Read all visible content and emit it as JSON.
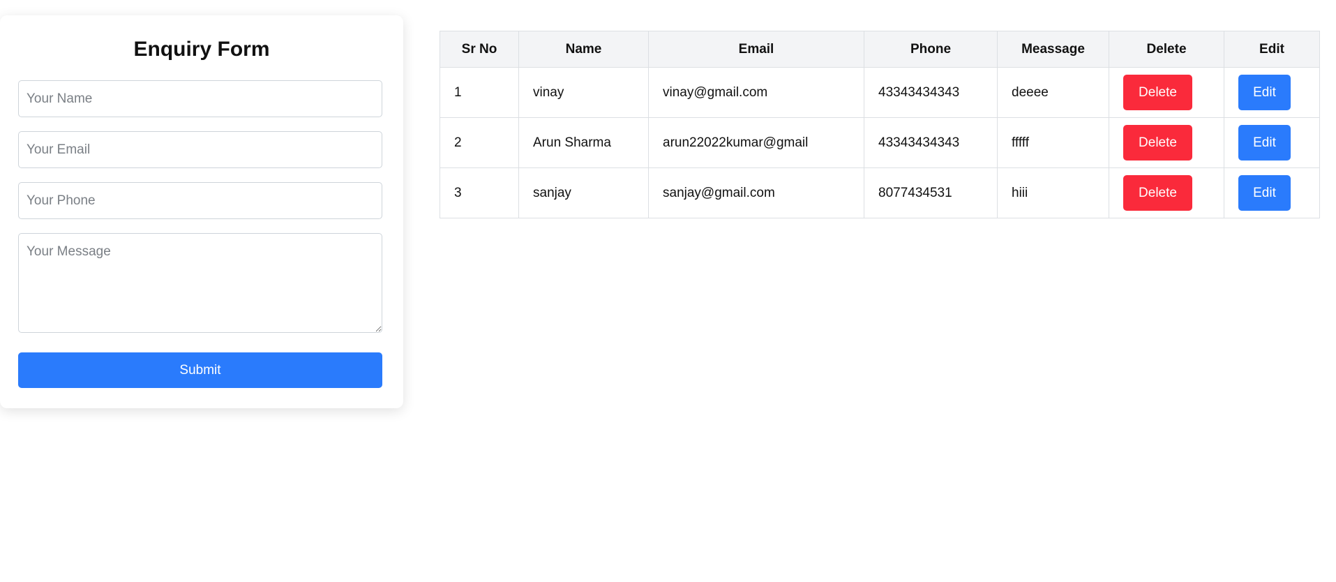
{
  "form": {
    "title": "Enquiry Form",
    "name_placeholder": "Your Name",
    "email_placeholder": "Your Email",
    "phone_placeholder": "Your Phone",
    "message_placeholder": "Your Message",
    "submit_label": "Submit"
  },
  "table": {
    "headers": [
      "Sr No",
      "Name",
      "Email",
      "Phone",
      "Meassage",
      "Delete",
      "Edit"
    ],
    "rows": [
      {
        "sr": "1",
        "name": "vinay",
        "email": "vinay@gmail.com",
        "phone": "43343434343",
        "message": "deeee",
        "delete_label": "Delete",
        "edit_label": "Edit"
      },
      {
        "sr": "2",
        "name": "Arun Sharma",
        "email": "arun22022kumar@gmail",
        "phone": "43343434343",
        "message": "fffff",
        "delete_label": "Delete",
        "edit_label": "Edit"
      },
      {
        "sr": "3",
        "name": "sanjay",
        "email": "sanjay@gmail.com",
        "phone": "8077434531",
        "message": "hiii",
        "delete_label": "Delete",
        "edit_label": "Edit"
      }
    ]
  },
  "colors": {
    "primary": "#2a7bfc",
    "danger": "#fa2a3b",
    "header_bg": "#f3f4f6"
  }
}
